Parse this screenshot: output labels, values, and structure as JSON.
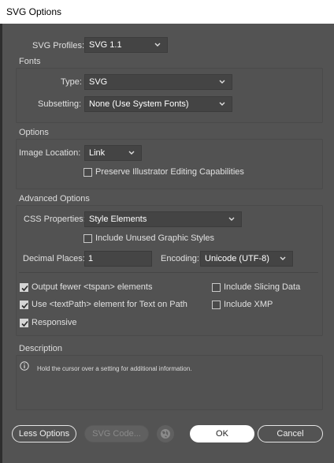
{
  "window": {
    "title": "SVG Options"
  },
  "profiles": {
    "label": "SVG Profiles:",
    "value": "SVG 1.1"
  },
  "fonts": {
    "title": "Fonts",
    "type_label": "Type:",
    "type_value": "SVG",
    "subsetting_label": "Subsetting:",
    "subsetting_value": "None (Use System Fonts)"
  },
  "options": {
    "title": "Options",
    "image_location_label": "Image Location:",
    "image_location_value": "Link",
    "preserve_label": "Preserve Illustrator Editing Capabilities",
    "preserve_checked": false
  },
  "advanced": {
    "title": "Advanced Options",
    "css_label": "CSS Properties:",
    "css_value": "Style Elements",
    "unused_styles_label": "Include Unused Graphic Styles",
    "unused_styles_checked": false,
    "decimal_label": "Decimal Places:",
    "decimal_value": "1",
    "encoding_label": "Encoding:",
    "encoding_value": "Unicode (UTF-8)",
    "checks": [
      {
        "label": "Output fewer <tspan> elements",
        "checked": true
      },
      {
        "label": "Include Slicing Data",
        "checked": false
      },
      {
        "label": "Use <textPath> element for Text on Path",
        "checked": true
      },
      {
        "label": "Include XMP",
        "checked": false
      },
      {
        "label": "Responsive",
        "checked": true
      }
    ]
  },
  "description": {
    "title": "Description",
    "text": "Hold the cursor over a setting for additional information."
  },
  "buttons": {
    "less_options": "Less Options",
    "svg_code": "SVG Code...",
    "ok": "OK",
    "cancel": "Cancel"
  },
  "colors": {
    "background": "#535353",
    "field": "#444444",
    "primary_button": "#ffffff"
  },
  "icons": [
    "chevron-down-icon",
    "checkmark-icon",
    "info-icon",
    "globe-icon"
  ]
}
